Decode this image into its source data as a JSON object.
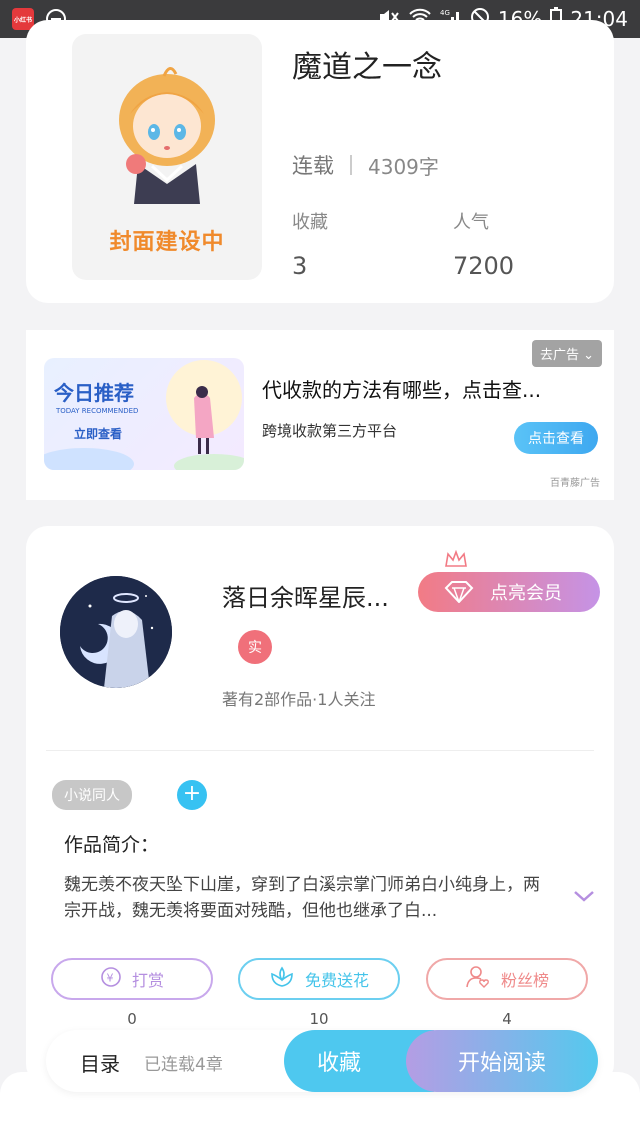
{
  "status_bar": {
    "app_badge": "小红书",
    "battery": "16%",
    "time": "21:04",
    "network": "4G"
  },
  "book": {
    "cover_text": "封面建设中",
    "title": "魔道之一念",
    "serial_status": "连载",
    "word_count": "4309字",
    "collect_label": "收藏",
    "collect_value": "3",
    "popularity_label": "人气",
    "popularity_value": "7200"
  },
  "ad": {
    "image_title": "今日推荐",
    "image_sub": "TODAY RECOMMENDED",
    "image_cta": "立即查看",
    "close_label": "去广告",
    "title": "代收款的方法有哪些，点击查...",
    "subtitle": "跨境收款第三方平台",
    "button": "点击查看",
    "source": "百青藤广告"
  },
  "author": {
    "name": "落日余晖星辰...",
    "vip_button": "点亮会员",
    "real_badge": "实",
    "meta": "著有2部作品·1人关注",
    "tag": "小说同人",
    "add_tag": "+",
    "intro_label": "作品简介：",
    "intro_text": "魏无羡不夜天坠下山崖，穿到了白溪宗掌门师弟白小纯身上，两宗开战，魏无羡将要面对残酷，但他也继承了白..."
  },
  "actions": [
    {
      "label": "打赏",
      "count": "0",
      "icon": "yen-icon",
      "color": "#b58fe0"
    },
    {
      "label": "免费送花",
      "count": "10",
      "icon": "flower-icon",
      "color": "#45c4ea"
    },
    {
      "label": "粉丝榜",
      "count": "4",
      "icon": "user-heart-icon",
      "color": "#ef8a8a"
    }
  ],
  "bottom_bar": {
    "toc": "目录",
    "chapters": "已连载4章",
    "favorite": "收藏",
    "start_read": "开始阅读"
  }
}
